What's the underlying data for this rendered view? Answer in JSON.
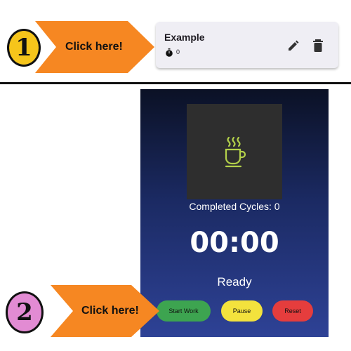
{
  "steps": [
    {
      "number": "1",
      "callout": "Click here!"
    },
    {
      "number": "2",
      "callout": "Click here!"
    }
  ],
  "card": {
    "title": "Example",
    "count": "0",
    "icons": {
      "timer": "timer-icon",
      "edit": "pencil-icon",
      "delete": "trash-icon"
    }
  },
  "pomodoro": {
    "image_icon": "coffee-cup-icon",
    "completed_cycles": "Completed Cycles: 0",
    "timer": "00:00",
    "status": "Ready",
    "buttons": {
      "start": "Start Work",
      "pause": "Pause",
      "reset": "Reset"
    }
  },
  "colors": {
    "arrow_orange": "#f68722",
    "badge1": "#f6c51b",
    "badge2": "#e28bd3",
    "start_green": "#3da450",
    "pause_yellow": "#f3e23d",
    "reset_red": "#e53d3d",
    "coffee_green": "#b3d14a"
  }
}
